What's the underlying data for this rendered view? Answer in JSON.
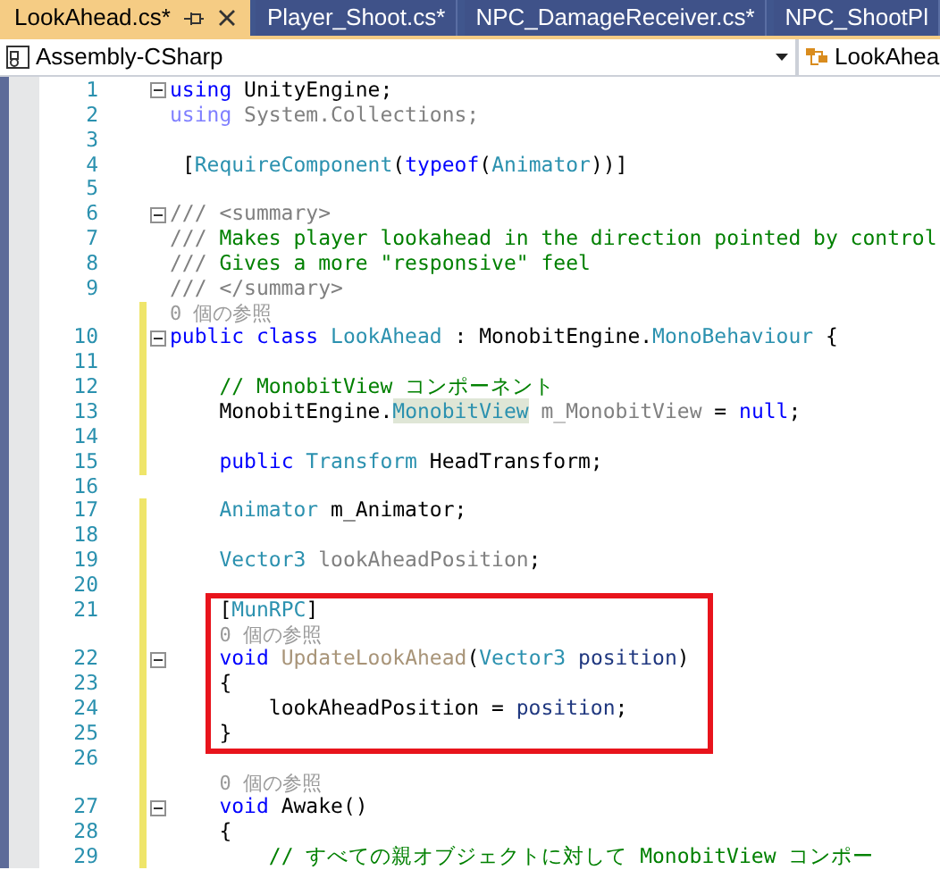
{
  "tabs": [
    {
      "label": "LookAhead.cs*",
      "selected": true,
      "pinned": true,
      "closable": true
    },
    {
      "label": "Player_Shoot.cs*",
      "selected": false,
      "pinned": false,
      "closable": false
    },
    {
      "label": "NPC_DamageReceiver.cs*",
      "selected": false,
      "pinned": false,
      "closable": false
    },
    {
      "label": "NPC_ShootPl",
      "selected": false,
      "pinned": false,
      "closable": false
    }
  ],
  "navigation_bar": {
    "project_dropdown": "Assembly-CSharp",
    "class_dropdown": "LookAhea"
  },
  "code_lines": [
    {
      "number": "1",
      "changed": false,
      "fold": true,
      "boxed": false,
      "segments": [
        {
          "kind": "keyword",
          "text": "using"
        },
        {
          "kind": "plain",
          "text": " UnityEngine;"
        }
      ]
    },
    {
      "number": "2",
      "changed": false,
      "fold": false,
      "boxed": false,
      "segments": [
        {
          "kind": "faded_keyword",
          "text": "using"
        },
        {
          "kind": "faded",
          "text": " System.Collections;"
        }
      ]
    },
    {
      "number": "3",
      "changed": false,
      "fold": false,
      "boxed": false
    },
    {
      "number": "4",
      "changed": false,
      "fold": false,
      "boxed": false,
      "segments": [
        {
          "kind": "plain",
          "text": " ["
        },
        {
          "kind": "type",
          "text": "RequireComponent"
        },
        {
          "kind": "plain",
          "text": "("
        },
        {
          "kind": "keyword",
          "text": "typeof"
        },
        {
          "kind": "plain",
          "text": "("
        },
        {
          "kind": "type",
          "text": "Animator"
        },
        {
          "kind": "plain",
          "text": "))]"
        }
      ]
    },
    {
      "number": "5",
      "changed": false,
      "fold": false,
      "boxed": false
    },
    {
      "number": "6",
      "changed": false,
      "fold": true,
      "boxed": false,
      "segments": [
        {
          "kind": "doc_tag",
          "text": "/// <summary>"
        }
      ]
    },
    {
      "number": "7",
      "changed": false,
      "fold": false,
      "boxed": false,
      "segments": [
        {
          "kind": "doc_tag",
          "text": "///"
        },
        {
          "kind": "comment",
          "text": " Makes player lookahead in the direction pointed by control"
        }
      ]
    },
    {
      "number": "8",
      "changed": false,
      "fold": false,
      "boxed": false,
      "segments": [
        {
          "kind": "doc_tag",
          "text": "///"
        },
        {
          "kind": "comment",
          "text": " Gives a more \"responsive\" feel"
        }
      ]
    },
    {
      "number": "9",
      "changed": false,
      "fold": false,
      "boxed": false,
      "segments": [
        {
          "kind": "doc_tag",
          "text": "/// </summary>"
        }
      ]
    },
    {
      "kind": "lens",
      "changed": true,
      "boxed": false,
      "text": "0 個の参照"
    },
    {
      "number": "10",
      "changed": true,
      "fold": true,
      "boxed": false,
      "segments": [
        {
          "kind": "keyword",
          "text": "public class"
        },
        {
          "kind": "type",
          "text": " LookAhead"
        },
        {
          "kind": "plain",
          "text": " : MonobitEngine."
        },
        {
          "kind": "type",
          "text": "MonoBehaviour"
        },
        {
          "kind": "plain",
          "text": " {"
        }
      ]
    },
    {
      "number": "11",
      "changed": true,
      "fold": false,
      "boxed": false
    },
    {
      "number": "12",
      "changed": true,
      "fold": false,
      "boxed": false,
      "segments": [
        {
          "kind": "comment",
          "text": "    // MonobitView コンポーネント"
        }
      ]
    },
    {
      "number": "13",
      "changed": true,
      "fold": false,
      "boxed": false,
      "segments": [
        {
          "kind": "plain",
          "text": "    MonobitEngine."
        },
        {
          "kind": "highlighted_type",
          "text": "MonobitView"
        },
        {
          "kind": "faded",
          "text": " m_MonobitView"
        },
        {
          "kind": "plain",
          "text": " = "
        },
        {
          "kind": "keyword",
          "text": "null"
        },
        {
          "kind": "plain",
          "text": ";"
        }
      ]
    },
    {
      "number": "14",
      "changed": true,
      "fold": false,
      "boxed": false
    },
    {
      "number": "15",
      "changed": true,
      "fold": false,
      "boxed": false,
      "segments": [
        {
          "kind": "keyword",
          "text": "    public"
        },
        {
          "kind": "type",
          "text": " Transform"
        },
        {
          "kind": "plain",
          "text": " HeadTransform;"
        }
      ]
    },
    {
      "number": "16",
      "changed": false,
      "fold": false,
      "boxed": false
    },
    {
      "number": "17",
      "changed": true,
      "fold": false,
      "boxed": false,
      "segments": [
        {
          "kind": "type",
          "text": "    Animator"
        },
        {
          "kind": "plain",
          "text": " m_Animator;"
        }
      ]
    },
    {
      "number": "18",
      "changed": true,
      "fold": false,
      "boxed": false
    },
    {
      "number": "19",
      "changed": true,
      "fold": false,
      "boxed": false,
      "segments": [
        {
          "kind": "type",
          "text": "    Vector3"
        },
        {
          "kind": "faded",
          "text": " lookAheadPosition"
        },
        {
          "kind": "plain",
          "text": ";"
        }
      ]
    },
    {
      "number": "20",
      "changed": true,
      "fold": false,
      "boxed": false
    },
    {
      "number": "21",
      "changed": true,
      "fold": false,
      "boxed": true,
      "segments": [
        {
          "kind": "plain",
          "text": "    ["
        },
        {
          "kind": "type",
          "text": "MunRPC"
        },
        {
          "kind": "plain",
          "text": "]"
        }
      ]
    },
    {
      "kind": "lens",
      "changed": true,
      "boxed": true,
      "text": "    0 個の参照"
    },
    {
      "number": "22",
      "changed": true,
      "fold": true,
      "boxed": true,
      "segments": [
        {
          "kind": "keyword",
          "text": "    void"
        },
        {
          "kind": "faded_method",
          "text": " UpdateLookAhead"
        },
        {
          "kind": "plain",
          "text": "("
        },
        {
          "kind": "type",
          "text": "Vector3"
        },
        {
          "kind": "parameter",
          "text": " position"
        },
        {
          "kind": "plain",
          "text": ")"
        }
      ]
    },
    {
      "number": "23",
      "changed": true,
      "fold": false,
      "boxed": true,
      "segments": [
        {
          "kind": "plain",
          "text": "    {"
        }
      ]
    },
    {
      "number": "24",
      "changed": true,
      "fold": false,
      "boxed": true,
      "segments": [
        {
          "kind": "plain",
          "text": "        lookAheadPosition = "
        },
        {
          "kind": "parameter",
          "text": "position"
        },
        {
          "kind": "plain",
          "text": ";"
        }
      ]
    },
    {
      "number": "25",
      "changed": true,
      "fold": false,
      "boxed": true,
      "segments": [
        {
          "kind": "plain",
          "text": "    }"
        }
      ]
    },
    {
      "number": "26",
      "changed": true,
      "fold": false,
      "boxed": false
    },
    {
      "kind": "lens",
      "changed": true,
      "boxed": false,
      "text": "    0 個の参照"
    },
    {
      "number": "27",
      "changed": true,
      "fold": true,
      "boxed": false,
      "segments": [
        {
          "kind": "keyword",
          "text": "    void"
        },
        {
          "kind": "plain",
          "text": " Awake()"
        }
      ]
    },
    {
      "number": "28",
      "changed": true,
      "fold": false,
      "boxed": false,
      "segments": [
        {
          "kind": "plain",
          "text": "    {"
        }
      ]
    },
    {
      "number": "29",
      "changed": true,
      "fold": false,
      "boxed": false,
      "segments": [
        {
          "kind": "comment",
          "text": "        // すべての親オブジェクトに対して MonobitView コンポー"
        }
      ]
    }
  ]
}
